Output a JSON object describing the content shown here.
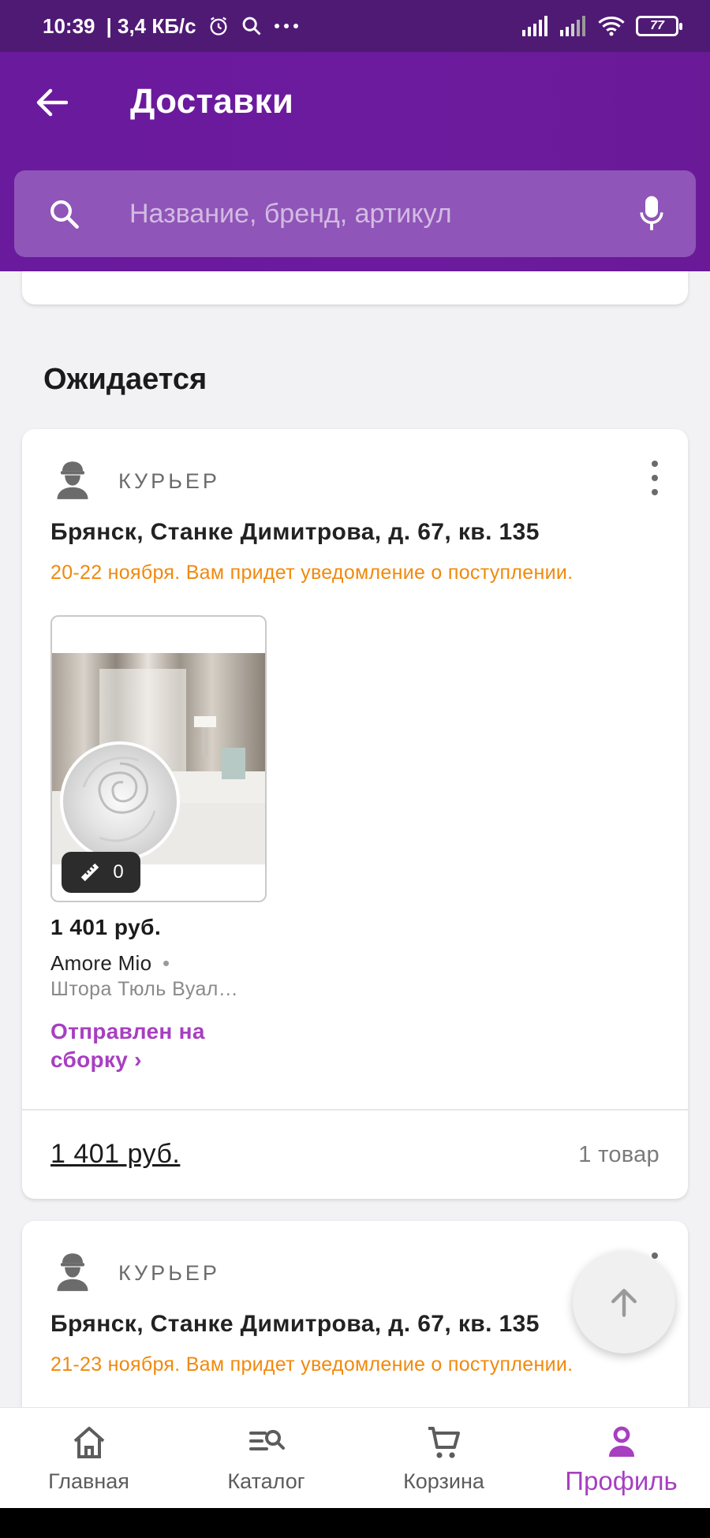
{
  "status_bar": {
    "time": "10:39",
    "speed": "| 3,4 КБ/с",
    "battery": "77",
    "icons": [
      "alarm-icon",
      "search-icon",
      "more-dots-icon",
      "signal-icon",
      "signal-icon",
      "wifi-icon",
      "battery-icon"
    ]
  },
  "header": {
    "title": "Доставки",
    "search_placeholder": "Название, бренд, артикул"
  },
  "section": {
    "expected_title": "Ожидается"
  },
  "deliveries": [
    {
      "type_label": "КУРЬЕР",
      "address": "Брянск, Станке Димитрова, д. 67, кв. 135",
      "eta": "20-22 ноября. Вам придет уведомление о поступлении.",
      "item": {
        "size_count": "0",
        "price": "1 401 руб.",
        "brand": "Amore Mio",
        "brand_sep": "•",
        "name": "Штора Тюль Вуал…",
        "status": "Отправлен на сборку ›"
      },
      "total": "1 401 руб.",
      "count": "1 товар"
    },
    {
      "type_label": "КУРЬЕР",
      "address": "Брянск, Станке Димитрова, д. 67, кв. 135",
      "eta": "21-23 ноября. Вам придет уведомление о поступлении."
    }
  ],
  "bottom_nav": {
    "items": [
      {
        "label": "Главная",
        "icon": "home-icon"
      },
      {
        "label": "Каталог",
        "icon": "catalog-search-icon"
      },
      {
        "label": "Корзина",
        "icon": "cart-icon"
      },
      {
        "label": "Профиль",
        "icon": "profile-icon"
      }
    ],
    "active": "Профиль"
  },
  "colors": {
    "status_bar": "#4f1a74",
    "app_bar": "#6a1a9d",
    "search_bg": "#9055b8",
    "accent": "#a73fc0",
    "eta": "#f1890c"
  }
}
